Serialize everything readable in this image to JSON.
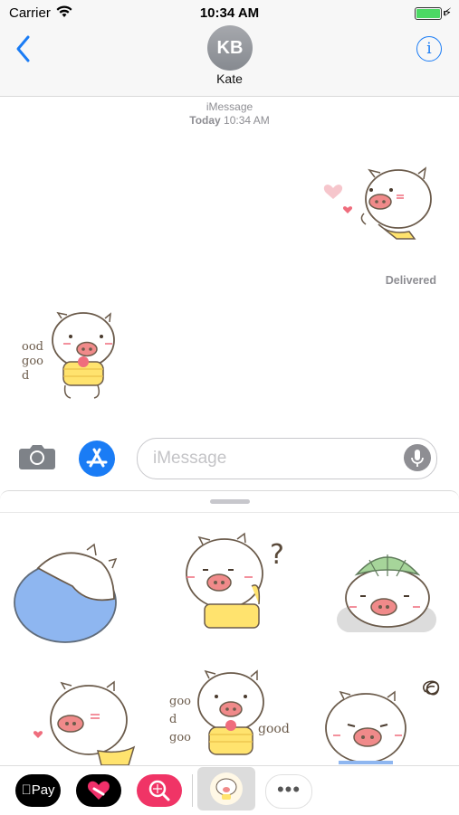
{
  "status_bar": {
    "carrier": "Carrier",
    "time": "10:34 AM",
    "battery_color": "#4cd964"
  },
  "header": {
    "avatar_initials": "KB",
    "contact_name": "Kate",
    "info_glyph": "i"
  },
  "thread": {
    "service": "iMessage",
    "timestamp_day": "Today",
    "timestamp_time": "10:34 AM",
    "delivered": "Delivered",
    "received_sticker_text": "ood\ngoo\nd"
  },
  "compose": {
    "placeholder": "iMessage"
  },
  "drawer": {
    "stickers": [
      "sleeping-pig",
      "confused-pig",
      "pig-in-hat",
      "shy-pig-heart",
      "good-good-pig",
      "frustrated-pig"
    ],
    "sticker_texts": {
      "question": "?",
      "good_left": "goo\nd\ngoo",
      "good_right": "good"
    }
  },
  "app_strip": {
    "apple_pay_label": "Pay",
    "more_label": "•••"
  },
  "colors": {
    "accent": "#1a7cf5",
    "pig_snout": "#f08a8a",
    "heart": "#f08a95"
  }
}
